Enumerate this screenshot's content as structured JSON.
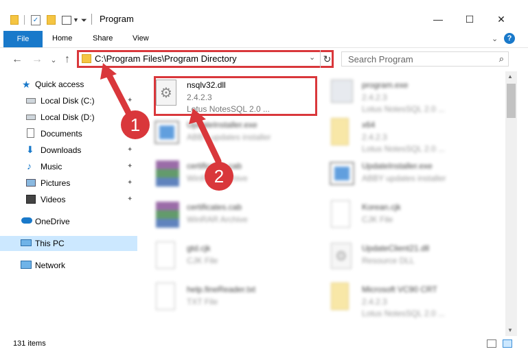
{
  "window": {
    "title": "Program",
    "minimize_glyph": "—",
    "maximize_glyph": "☐",
    "close_glyph": "✕"
  },
  "ribbon": {
    "tabs": [
      "File",
      "Home",
      "Share",
      "View"
    ],
    "expand_glyph": "⌄",
    "help_glyph": "?"
  },
  "nav": {
    "back_glyph": "←",
    "forward_glyph": "→",
    "recent_glyph": "⌄",
    "up_glyph": "↑",
    "address_path": "C:\\Program Files\\Program Directory",
    "address_dropdown_glyph": "⌄",
    "refresh_glyph": "↻",
    "search_placeholder": "Search Program",
    "search_glyph": "⌕"
  },
  "sidebar": {
    "items": [
      {
        "label": "Quick access",
        "icon": "star-icon",
        "pinned": false
      },
      {
        "label": "Local Disk (C:)",
        "icon": "drive-icon",
        "pinned": true
      },
      {
        "label": "Local Disk (D:)",
        "icon": "drive-icon",
        "pinned": false
      },
      {
        "label": "Documents",
        "icon": "documents-icon",
        "pinned": true
      },
      {
        "label": "Downloads",
        "icon": "download-icon",
        "pinned": true
      },
      {
        "label": "Music",
        "icon": "music-icon",
        "pinned": true
      },
      {
        "label": "Pictures",
        "icon": "pictures-icon",
        "pinned": true
      },
      {
        "label": "Videos",
        "icon": "videos-icon",
        "pinned": true
      },
      {
        "label": "OneDrive",
        "icon": "cloud-icon",
        "pinned": false
      },
      {
        "label": "This PC",
        "icon": "computer-icon",
        "pinned": false,
        "selected": true
      },
      {
        "label": "Network",
        "icon": "network-icon",
        "pinned": false
      }
    ],
    "pin_glyph": "📌"
  },
  "files": [
    {
      "name": "nsqlv32.dll",
      "line2": "2.4.2.3",
      "line3": "Lotus NotesSQL 2.0 ...",
      "icon": "dll-gear-icon",
      "highlighted": true
    },
    {
      "name": "program.exe",
      "line2": "2.4.2.3",
      "line3": "Lotus NotesSQL 2.0 ...",
      "icon": "exe-icon"
    },
    {
      "name": "UpdateInstaller.exe",
      "line2": "ABBY updates installer",
      "line3": "",
      "icon": "installer-icon"
    },
    {
      "name": "x64",
      "line2": "2.4.2.3",
      "line3": "Lotus NotesSQL 2.0 ...",
      "icon": "folder-icon"
    },
    {
      "name": "certificates.cab",
      "line2": "WinRAR Archive",
      "line3": "",
      "icon": "archive-icon"
    },
    {
      "name": "UpdateInstaller.exe",
      "line2": "ABBY updates installer",
      "line3": "",
      "icon": "installer-icon"
    },
    {
      "name": "certificates.cab",
      "line2": "WinRAR Archive",
      "line3": "",
      "icon": "archive-icon"
    },
    {
      "name": "Korean.cjk",
      "line2": "CJK File",
      "line3": "",
      "icon": "file-icon"
    },
    {
      "name": "gtd.cjk",
      "line2": "CJK File",
      "line3": "",
      "icon": "file-icon"
    },
    {
      "name": "UpdateClient21.dll",
      "line2": "Resource DLL",
      "line3": "",
      "icon": "dll-gear-icon"
    },
    {
      "name": "help.fineReader.txt",
      "line2": "TXT File",
      "line3": "",
      "icon": "text-file-icon"
    },
    {
      "name": "Microsoft VC90 CRT",
      "line2": "2.4.2.3",
      "line3": "Lotus NotesSQL 2.0 ...",
      "icon": "folder-icon"
    }
  ],
  "status": {
    "items_count": "131 items"
  },
  "callouts": [
    "1",
    "2"
  ],
  "colors": {
    "accent": "#1979ca",
    "highlight": "#d9373b",
    "selected_bg": "#cce8ff"
  }
}
